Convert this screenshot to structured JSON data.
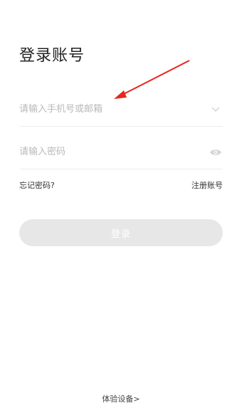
{
  "login": {
    "title": "登录账号",
    "account_field": {
      "value": "",
      "placeholder": "请输入手机号或邮箱",
      "dropdown_icon": "chevron-down-icon"
    },
    "password_field": {
      "value": "",
      "placeholder": "请输入密码",
      "visibility_icon": "eye-icon"
    },
    "forgot_password_label": "忘记密码?",
    "register_label": "注册账号",
    "login_button_label": "登录",
    "experience_link_label": "体验设备>"
  },
  "colors": {
    "background": "#ffffff",
    "button_disabled": "#e7e7e7",
    "annotation_arrow": "#e8261e",
    "placeholder_text": "#b9b9b9"
  }
}
